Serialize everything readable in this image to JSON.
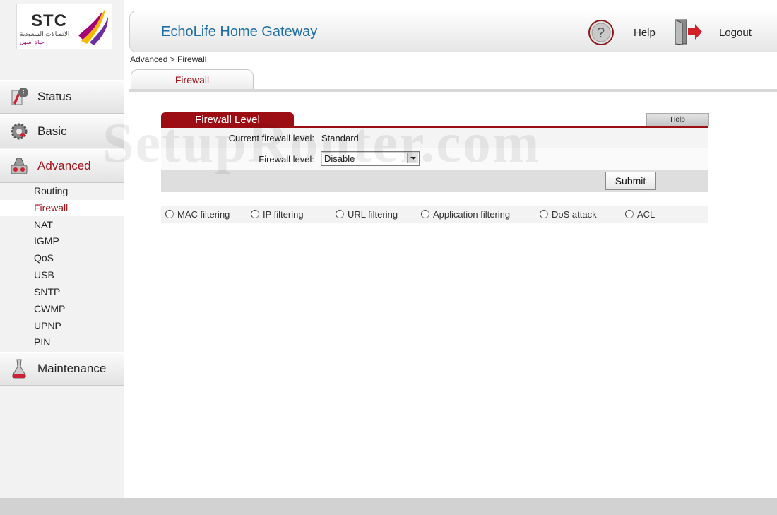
{
  "brand": {
    "logo_text": "STC",
    "logo_arabic": "الاتصالات السعودية",
    "logo_tagline": "حياة أسهل"
  },
  "header": {
    "title": "EchoLife Home Gateway",
    "help_label": "Help",
    "logout_label": "Logout"
  },
  "sidebar": {
    "main_items": [
      {
        "label": "Status",
        "icon": "status-icon"
      },
      {
        "label": "Basic",
        "icon": "gear-icon"
      },
      {
        "label": "Advanced",
        "icon": "advanced-icon",
        "active": true
      },
      {
        "label": "Maintenance",
        "icon": "maintenance-icon"
      }
    ],
    "advanced_subitems": [
      "Routing",
      "Firewall",
      "NAT",
      "IGMP",
      "QoS",
      "USB",
      "SNTP",
      "CWMP",
      "UPNP",
      "PIN"
    ],
    "active_subitem": "Firewall"
  },
  "breadcrumb": "Advanced > Firewall",
  "tab": {
    "label": "Firewall"
  },
  "watermark": "SetupRouter.com",
  "panel": {
    "title": "Firewall Level",
    "help_label": "Help",
    "current_level_label": "Current firewall level:",
    "current_level_value": "Standard",
    "level_label": "Firewall level:",
    "level_selected": "Disable",
    "submit_label": "Submit"
  },
  "filter_options": [
    "MAC filtering",
    "IP filtering",
    "URL filtering",
    "Application filtering",
    "DoS attack",
    "ACL"
  ],
  "colors": {
    "accent_red": "#9c0e14",
    "title_blue": "#1d6ea8",
    "active_text": "#a0141a"
  }
}
